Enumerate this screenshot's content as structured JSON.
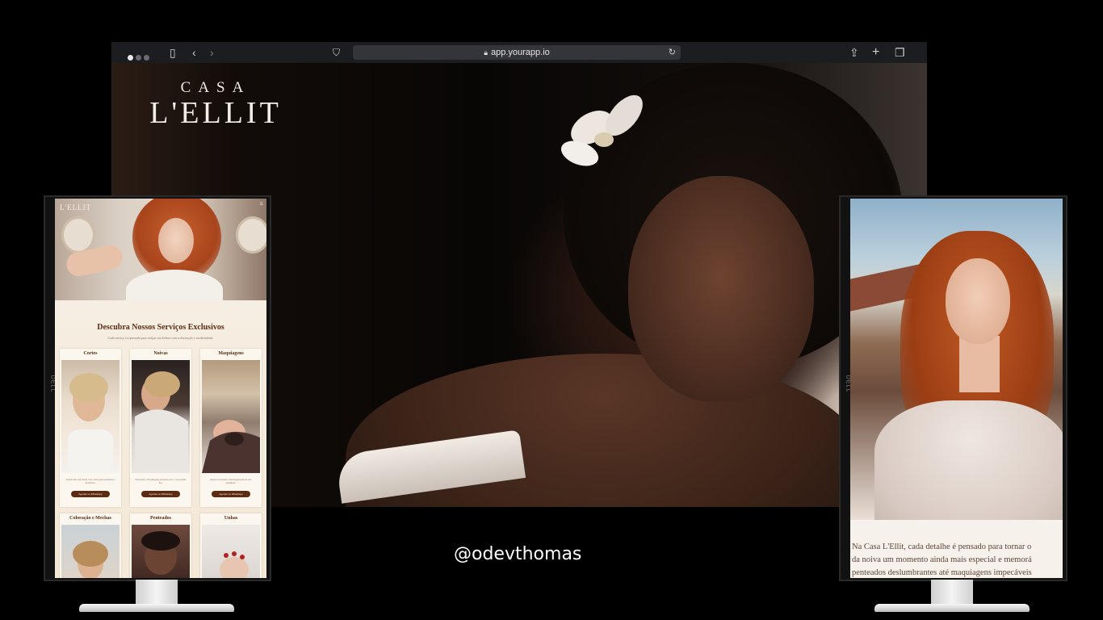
{
  "browser": {
    "url": "app.yourapp.io"
  },
  "hero": {
    "logo_top": "CASA",
    "logo_bottom": "L'ELLIT"
  },
  "left_site": {
    "minilogo": "L'ELLIT",
    "section_title": "Descubra Nossos Serviços Exclusivos",
    "section_subtitle": "Cada serviço foi pensado para realçar sua beleza com sofisticação e modernidade.",
    "cards": [
      {
        "title": "Cortes",
        "desc": "Transforme seu visual com cortes personalizados e modernos.",
        "button": "Agende no WhatsApp"
      },
      {
        "title": "Noivas",
        "desc": "Penteados e maquiagens pensados para o seu grande dia.",
        "button": "Agende no WhatsApp"
      },
      {
        "title": "Maquiagens",
        "desc": "Realce sua beleza com maquiagens de alta qualidade.",
        "button": "Agende no WhatsApp"
      }
    ],
    "cards_row2": [
      {
        "title": "Coloração e Mechas"
      },
      {
        "title": "Penteados"
      },
      {
        "title": "Unhas"
      }
    ]
  },
  "right_site": {
    "text_lines": [
      "Na Casa L'Ellit, cada detalhe é pensado para tornar o",
      "da noiva um momento ainda mais especial e memorá",
      "penteados deslumbrantes até maquiagens impecáveis"
    ]
  },
  "monitor_brand": "DELL",
  "handle": "@odevthomas",
  "colors": {
    "background": "#000000",
    "accent_brown": "#5b2b12",
    "cream": "#f6eee2"
  }
}
